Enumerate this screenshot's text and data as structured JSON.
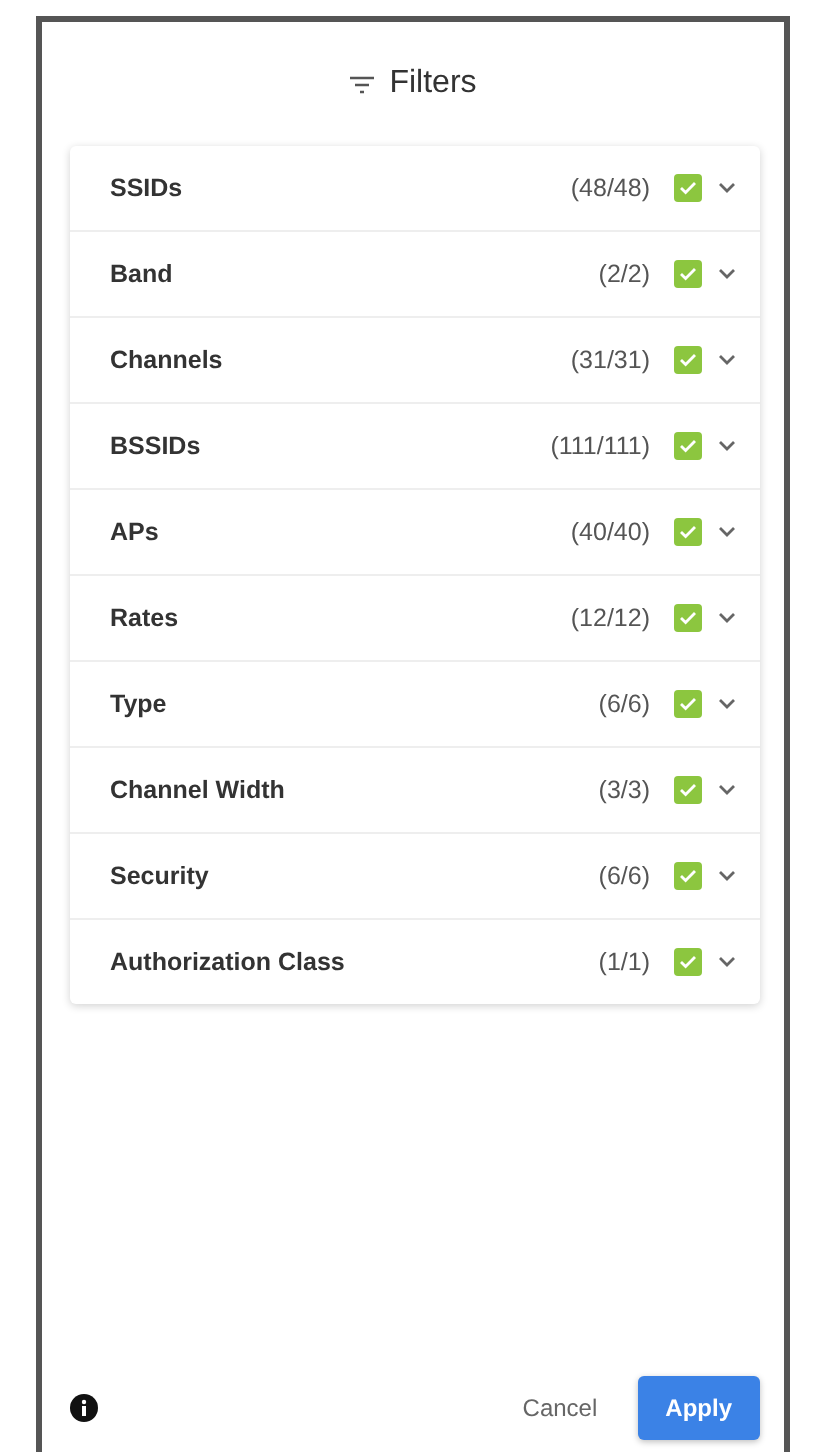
{
  "title": "Filters",
  "filters": [
    {
      "label": "SSIDs",
      "count": "(48/48)",
      "checked": true
    },
    {
      "label": "Band",
      "count": "(2/2)",
      "checked": true
    },
    {
      "label": "Channels",
      "count": "(31/31)",
      "checked": true
    },
    {
      "label": "BSSIDs",
      "count": "(111/111)",
      "checked": true
    },
    {
      "label": "APs",
      "count": "(40/40)",
      "checked": true
    },
    {
      "label": "Rates",
      "count": "(12/12)",
      "checked": true
    },
    {
      "label": "Type",
      "count": "(6/6)",
      "checked": true
    },
    {
      "label": "Channel Width",
      "count": "(3/3)",
      "checked": true
    },
    {
      "label": "Security",
      "count": "(6/6)",
      "checked": true
    },
    {
      "label": "Authorization Class",
      "count": "(1/1)",
      "checked": true
    }
  ],
  "buttons": {
    "cancel": "Cancel",
    "apply": "Apply"
  }
}
